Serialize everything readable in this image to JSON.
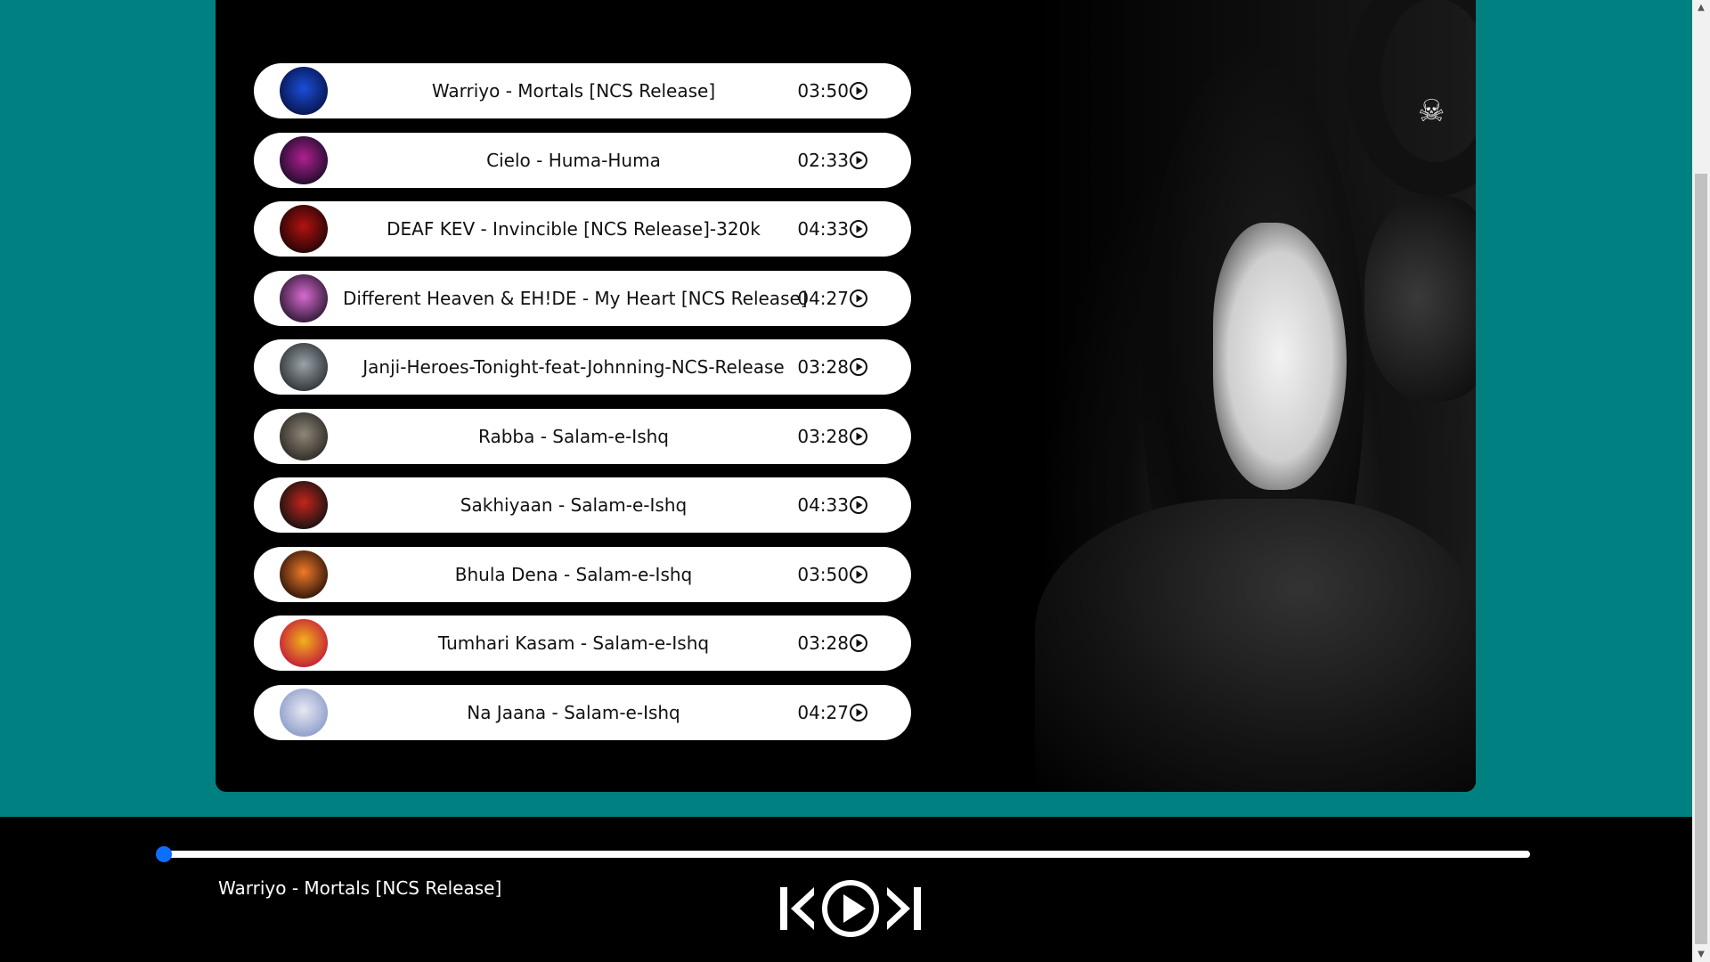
{
  "tracks": [
    {
      "title": "Warriyo - Mortals [NCS Release]",
      "duration": "03:50",
      "thumb_colors": [
        "#1a4fd8",
        "#06124a"
      ]
    },
    {
      "title": "Cielo - Huma-Huma",
      "duration": "02:33",
      "thumb_colors": [
        "#b0208f",
        "#1a0b2a"
      ]
    },
    {
      "title": "DEAF KEV - Invincible [NCS Release]-320k",
      "duration": "04:33",
      "thumb_colors": [
        "#b31212",
        "#200404"
      ]
    },
    {
      "title": "Different Heaven & EH!DE - My Heart [NCS Release]",
      "duration": "04:27",
      "thumb_colors": [
        "#d86bd0",
        "#2a1630"
      ]
    },
    {
      "title": "Janji-Heroes-Tonight-feat-Johnning-NCS-Release",
      "duration": "03:28",
      "thumb_colors": [
        "#9aa3a8",
        "#2b3034"
      ]
    },
    {
      "title": "Rabba - Salam-e-Ishq",
      "duration": "03:28",
      "thumb_colors": [
        "#8e8678",
        "#2c2924"
      ]
    },
    {
      "title": "Sakhiyaan - Salam-e-Ishq",
      "duration": "04:33",
      "thumb_colors": [
        "#c4251c",
        "#111111"
      ]
    },
    {
      "title": "Bhula Dena - Salam-e-Ishq",
      "duration": "03:50",
      "thumb_colors": [
        "#f07a2a",
        "#2a1208"
      ]
    },
    {
      "title": "Tumhari Kasam - Salam-e-Ishq",
      "duration": "03:28",
      "thumb_colors": [
        "#f2b21b",
        "#c2173a"
      ]
    },
    {
      "title": "Na Jaana - Salam-e-Ishq",
      "duration": "04:27",
      "thumb_colors": [
        "#e8e8f2",
        "#8a9bc9"
      ]
    }
  ],
  "player": {
    "now_playing": "Warriyo - Mortals [NCS Release]",
    "progress": 0,
    "accent": "#0d6efd"
  },
  "colors": {
    "background": "#008080",
    "panel": "#000000",
    "track_bg": "#ffffff"
  }
}
